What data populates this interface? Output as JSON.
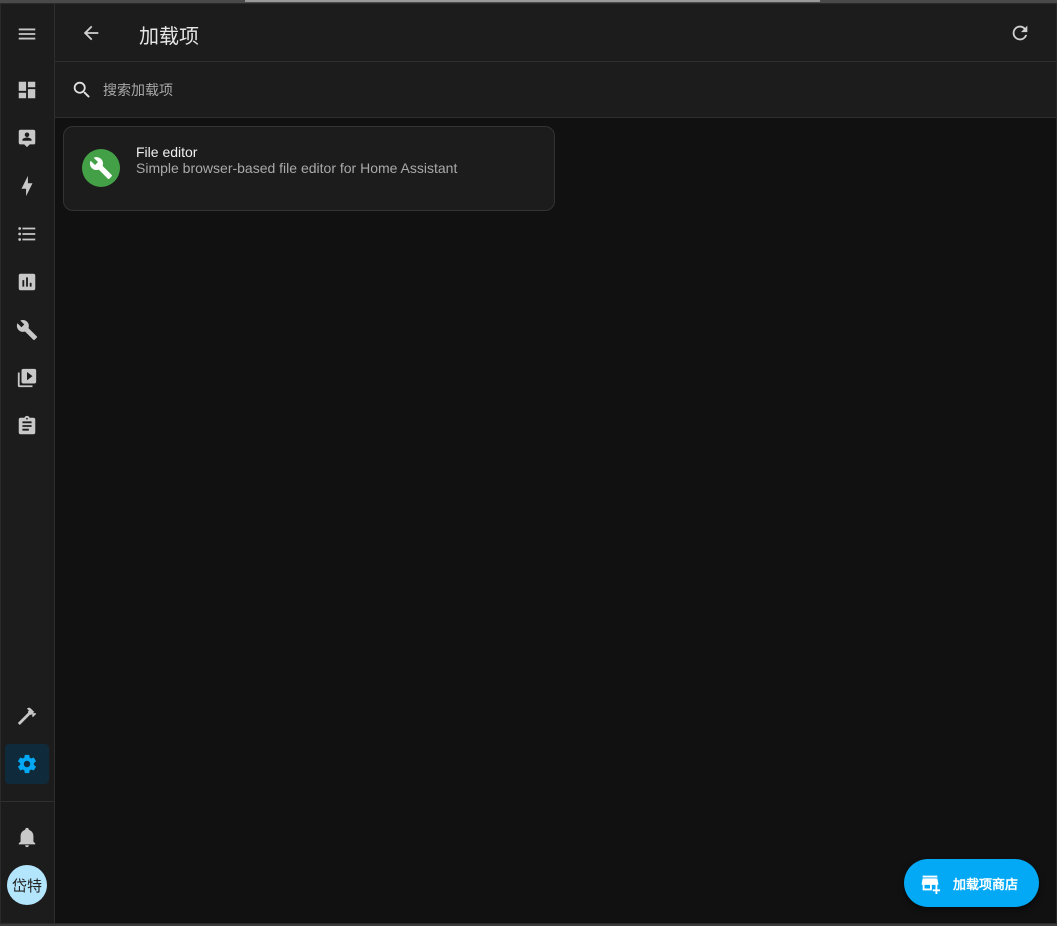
{
  "header": {
    "title": "加载项"
  },
  "search": {
    "placeholder": "搜索加载项",
    "value": ""
  },
  "addons": [
    {
      "name": "File editor",
      "description": "Simple browser-based file editor for Home Assistant",
      "icon": "wrench-icon",
      "icon_color": "#43a047"
    }
  ],
  "fab": {
    "label": "加载项商店",
    "icon": "store-plus-icon",
    "color": "#03a9f4"
  },
  "sidebar": {
    "items": [
      {
        "name": "menu",
        "icon": "menu-icon"
      },
      {
        "name": "overview",
        "icon": "dashboard-icon"
      },
      {
        "name": "map",
        "icon": "account-box-icon"
      },
      {
        "name": "energy",
        "icon": "lightning-icon"
      },
      {
        "name": "logbook",
        "icon": "list-icon"
      },
      {
        "name": "history",
        "icon": "chart-box-icon"
      },
      {
        "name": "file-editor",
        "icon": "wrench-icon"
      },
      {
        "name": "media",
        "icon": "play-box-multiple-icon"
      },
      {
        "name": "todo",
        "icon": "clipboard-list-icon"
      },
      {
        "name": "developer-tools",
        "icon": "hammer-icon"
      },
      {
        "name": "settings",
        "icon": "cog-icon",
        "active": true
      },
      {
        "name": "notifications",
        "icon": "bell-icon"
      }
    ],
    "user_initials": "岱特",
    "accent": "#03a9f4"
  }
}
